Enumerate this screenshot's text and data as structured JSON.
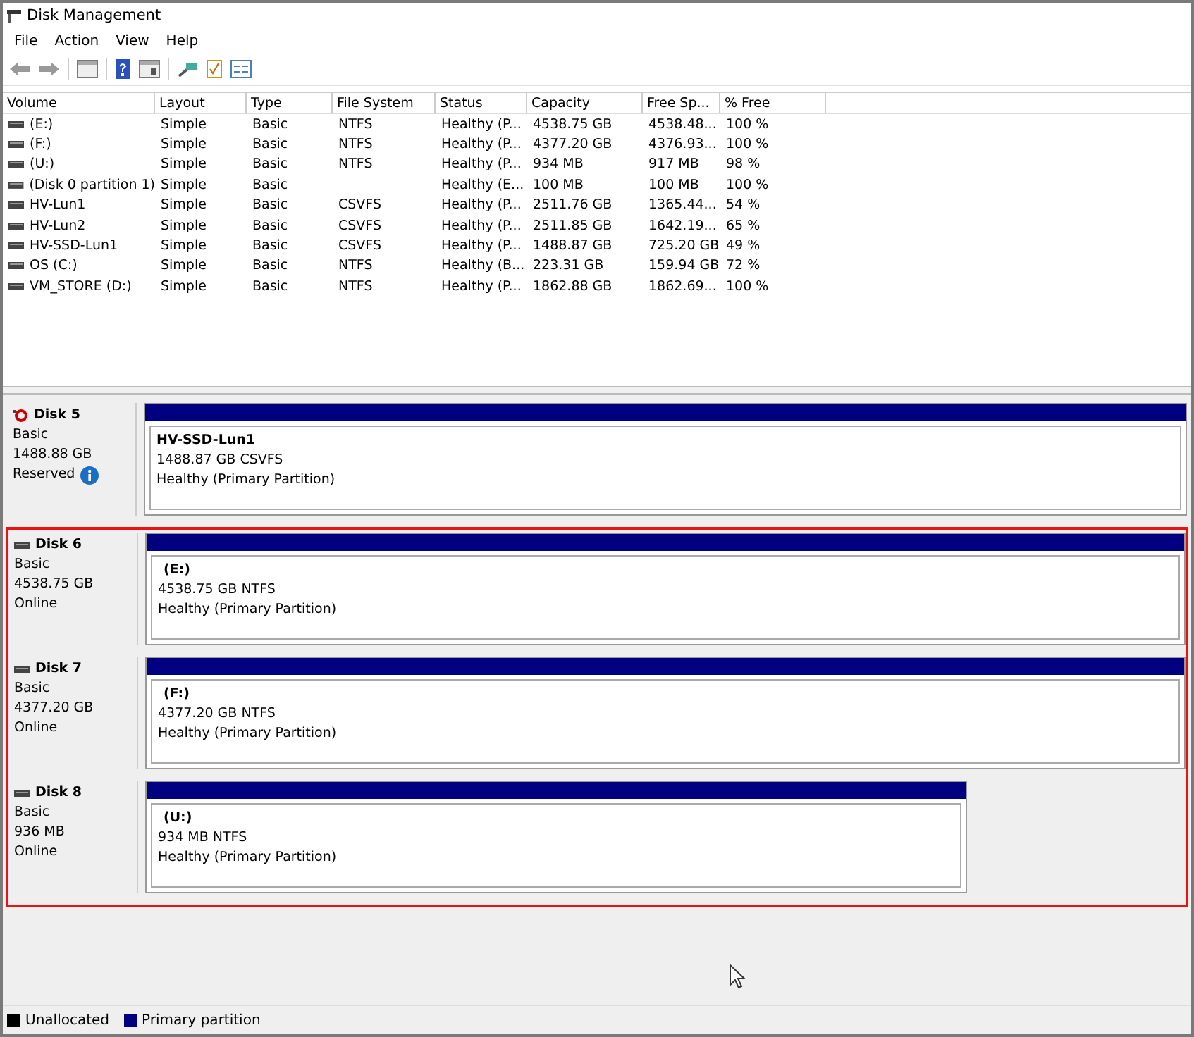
{
  "window": {
    "title": "Disk Management"
  },
  "menu": [
    "File",
    "Action",
    "View",
    "Help"
  ],
  "volume_list": {
    "columns": [
      "Volume",
      "Layout",
      "Type",
      "File System",
      "Status",
      "Capacity",
      "Free Sp...",
      "% Free"
    ],
    "rows": [
      [
        "(E:)",
        "Simple",
        "Basic",
        "NTFS",
        "Healthy (P...",
        "4538.75 GB",
        "4538.48...",
        "100 %"
      ],
      [
        "(F:)",
        "Simple",
        "Basic",
        "NTFS",
        "Healthy (P...",
        "4377.20 GB",
        "4376.93...",
        "100 %"
      ],
      [
        "(U:)",
        "Simple",
        "Basic",
        "NTFS",
        "Healthy (P...",
        "934 MB",
        "917 MB",
        "98 %"
      ],
      [
        "(Disk 0 partition 1)",
        "Simple",
        "Basic",
        "",
        "Healthy (E...",
        "100 MB",
        "100 MB",
        "100 %"
      ],
      [
        "HV-Lun1",
        "Simple",
        "Basic",
        "CSVFS",
        "Healthy (P...",
        "2511.76 GB",
        "1365.44...",
        "54 %"
      ],
      [
        "HV-Lun2",
        "Simple",
        "Basic",
        "CSVFS",
        "Healthy (P...",
        "2511.85 GB",
        "1642.19...",
        "65 %"
      ],
      [
        "HV-SSD-Lun1",
        "Simple",
        "Basic",
        "CSVFS",
        "Healthy (P...",
        "1488.87 GB",
        "725.20 GB",
        "49 %"
      ],
      [
        "OS (C:)",
        "Simple",
        "Basic",
        "NTFS",
        "Healthy (B...",
        "223.31 GB",
        "159.94 GB",
        "72 %"
      ],
      [
        "VM_STORE (D:)",
        "Simple",
        "Basic",
        "NTFS",
        "Healthy (P...",
        "1862.88 GB",
        "1862.69...",
        "100 %"
      ]
    ]
  },
  "disks": [
    {
      "name": "Disk 5",
      "kind": "reserved",
      "type": "Basic",
      "size": "1488.88 GB",
      "status": "Reserved",
      "highlighted": false,
      "partition": {
        "label": "HV-SSD-Lun1",
        "size": "1488.87 GB CSVFS",
        "health": "Healthy (Primary Partition)",
        "kind": "full"
      }
    },
    {
      "name": "Disk 6",
      "kind": "online",
      "type": "Basic",
      "size": "4538.75 GB",
      "status": "Online",
      "highlighted": true,
      "partition": {
        "label": "(E:)",
        "size": "4538.75 GB NTFS",
        "health": "Healthy (Primary Partition)",
        "kind": "full"
      }
    },
    {
      "name": "Disk 7",
      "kind": "online",
      "type": "Basic",
      "size": "4377.20 GB",
      "status": "Online",
      "highlighted": true,
      "partition": {
        "label": "(F:)",
        "size": "4377.20 GB NTFS",
        "health": "Healthy (Primary Partition)",
        "kind": "full"
      }
    },
    {
      "name": "Disk 8",
      "kind": "online",
      "type": "Basic",
      "size": "936 MB",
      "status": "Online",
      "highlighted": true,
      "partition": {
        "label": "(U:)",
        "size": "934 MB NTFS",
        "health": "Healthy (Primary Partition)",
        "kind": "partial"
      }
    }
  ],
  "legend": [
    {
      "label": "Unallocated",
      "color": "#000000"
    },
    {
      "label": "Primary partition",
      "color": "#000080"
    }
  ]
}
